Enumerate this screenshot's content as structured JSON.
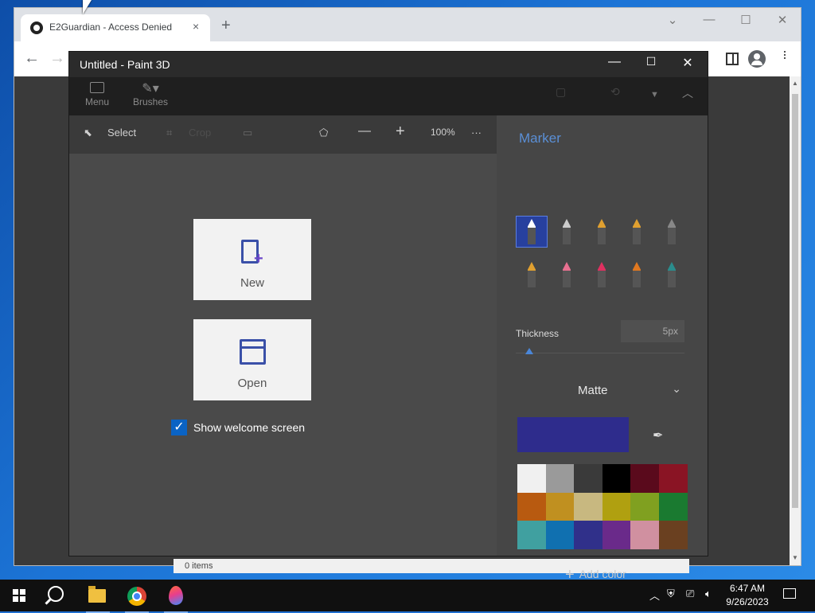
{
  "browser": {
    "tab_title": "E2Guardian - Access Denied",
    "tab_close": "×",
    "new_tab": "+",
    "icons": [
      "github-icon",
      "back-icon",
      "forward-icon",
      "side-panel-icon",
      "profile-icon",
      "kebab-menu-icon"
    ]
  },
  "explorer": {
    "status": "0 items"
  },
  "paint": {
    "title": "Untitled - Paint 3D",
    "ribbon": {
      "menu": "Menu",
      "brushes": "Brushes"
    },
    "toolbar": {
      "select": "Select",
      "crop": "Crop",
      "zoom": "100%",
      "more": "···"
    },
    "welcome": {
      "new": "New",
      "open": "Open",
      "show_welcome": "Show welcome screen",
      "show_welcome_checked": true
    },
    "panel": {
      "title": "Marker",
      "thickness_label": "Thickness",
      "thickness_value": "5px",
      "thickness_level": 0.05,
      "finish": "Matte",
      "current_color": "#2e2c8c",
      "add_color": "Add color",
      "brushes": [
        {
          "name": "marker",
          "color": "#ffffff",
          "selected": true
        },
        {
          "name": "calligraphy-pen",
          "color": "#cccccc"
        },
        {
          "name": "oil-brush",
          "color": "#e0a030"
        },
        {
          "name": "watercolor",
          "color": "#e0a030"
        },
        {
          "name": "pixel-pen",
          "color": "#888888"
        },
        {
          "name": "pencil",
          "color": "#e0a030"
        },
        {
          "name": "eraser",
          "color": "#e87090"
        },
        {
          "name": "crayon",
          "color": "#e03060"
        },
        {
          "name": "spray-can",
          "color": "#e07820"
        },
        {
          "name": "fill",
          "color": "#2a8c8c"
        }
      ],
      "palette": [
        "#f0f0f0",
        "#9a9a9a",
        "#3a3a3a",
        "#000000",
        "#5a0a1c",
        "#8a1424",
        "#b85a10",
        "#c09020",
        "#c8b880",
        "#b0a010",
        "#80a020",
        "#1a7a30",
        "#40a0a0",
        "#1070b0",
        "#30308a",
        "#6a2a8a",
        "#d090a0",
        "#6a4020"
      ]
    }
  },
  "taskbar": {
    "time": "6:47 AM",
    "date": "9/26/2023",
    "apps": [
      "file-explorer",
      "chrome",
      "paint-3d"
    ]
  }
}
